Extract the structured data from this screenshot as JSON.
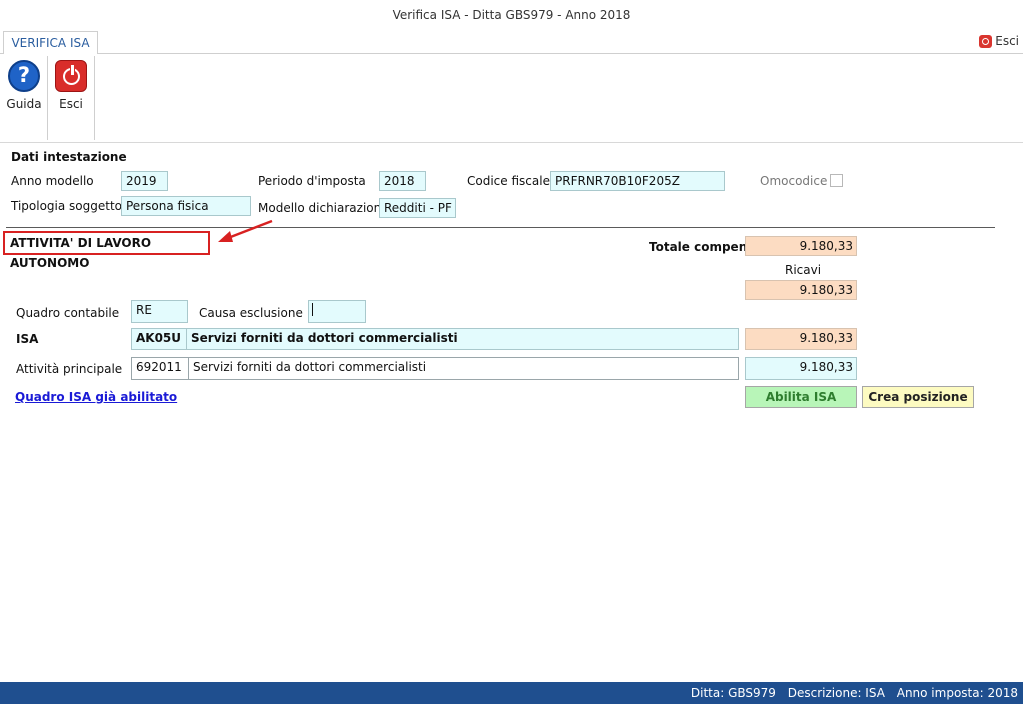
{
  "window": {
    "title": "Verifica ISA - Ditta GBS979 - Anno 2018"
  },
  "tabs": [
    {
      "label": "VERIFICA ISA"
    }
  ],
  "top_right": {
    "esci_label": "Esci"
  },
  "ribbon": {
    "guida_label": "Guida",
    "esci_label": "Esci"
  },
  "header_section": {
    "title": "Dati intestazione",
    "anno_modello_label": "Anno modello",
    "anno_modello_value": "2019",
    "periodo_label": "Periodo d'imposta",
    "periodo_value": "2018",
    "codice_fiscale_label": "Codice fiscale",
    "codice_fiscale_value": "PRFRNR70B10F205Z",
    "omocodice_label": "Omocodice",
    "tipologia_label": "Tipologia soggetto",
    "tipologia_value": "Persona fisica",
    "modello_label": "Modello dichiarazione",
    "modello_value": "Redditi - PF"
  },
  "activity_section": {
    "title": "ATTIVITA' DI LAVORO AUTONOMO",
    "totale_compensi_label": "Totale compensi",
    "totale_compensi_value": "9.180,33",
    "ricavi_label": "Ricavi",
    "ricavi_value": "9.180,33",
    "quadro_contabile_label": "Quadro contabile",
    "quadro_contabile_value": "RE",
    "causa_esclusione_label": "Causa esclusione",
    "causa_esclusione_value": "",
    "isa_label": "ISA",
    "isa_code": "AK05U",
    "isa_description": "Servizi forniti da dottori commercialisti",
    "isa_value": "9.180,33",
    "attivita_label": "Attività principale",
    "attivita_code": "692011",
    "attivita_description": "Servizi forniti da dottori commercialisti",
    "attivita_value": "9.180,33",
    "link_label": "Quadro ISA già abilitato",
    "abilita_label": "Abilita ISA",
    "crea_label": "Crea posizione"
  },
  "statusbar": {
    "ditta": "Ditta: GBS979",
    "descrizione": "Descrizione: ISA",
    "anno": "Anno imposta: 2018"
  },
  "colors": {
    "accent_blue": "#1f4f8f",
    "highlight_red": "#d82121",
    "field_cyan": "#e3fbfd",
    "field_orange": "#fcdcc2"
  }
}
